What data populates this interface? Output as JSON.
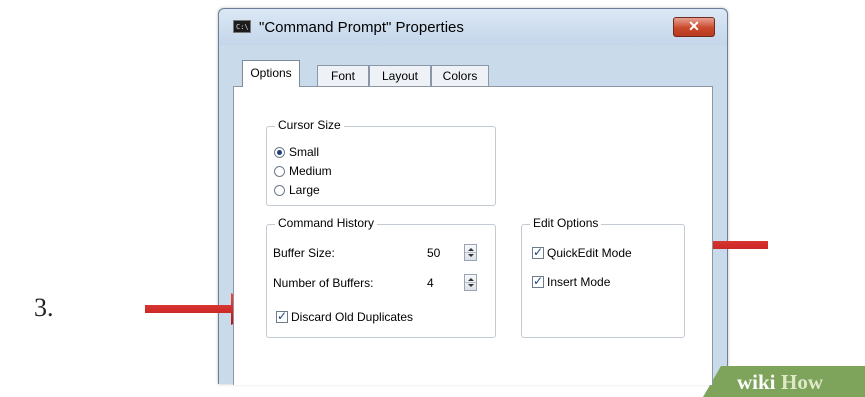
{
  "step_number": "3.",
  "window": {
    "title": "\"Command Prompt\" Properties",
    "close_glyph": "✕",
    "icon": "console-icon",
    "icon_text": "C:\\"
  },
  "tabs": [
    {
      "label": "Options",
      "active": true
    },
    {
      "label": "Font",
      "active": false
    },
    {
      "label": "Layout",
      "active": false
    },
    {
      "label": "Colors",
      "active": false
    }
  ],
  "cursor_size": {
    "title": "Cursor Size",
    "options": [
      {
        "label": "Small",
        "checked": true
      },
      {
        "label": "Medium",
        "checked": false
      },
      {
        "label": "Large",
        "checked": false
      }
    ]
  },
  "command_history": {
    "title": "Command History",
    "buffer_size_label": "Buffer Size:",
    "buffer_size_value": "50",
    "number_of_buffers_label": "Number of Buffers:",
    "number_of_buffers_value": "4",
    "discard_old_duplicates_label": "Discard Old Duplicates",
    "discard_old_duplicates_checked": true
  },
  "edit_options": {
    "title": "Edit Options",
    "quickedit_label": "QuickEdit Mode",
    "quickedit_checked": true,
    "insert_label": "Insert Mode",
    "insert_checked": true
  },
  "annotation_color": "#d7272b",
  "watermark": {
    "text_wiki": "wiki",
    "text_how": "How"
  }
}
